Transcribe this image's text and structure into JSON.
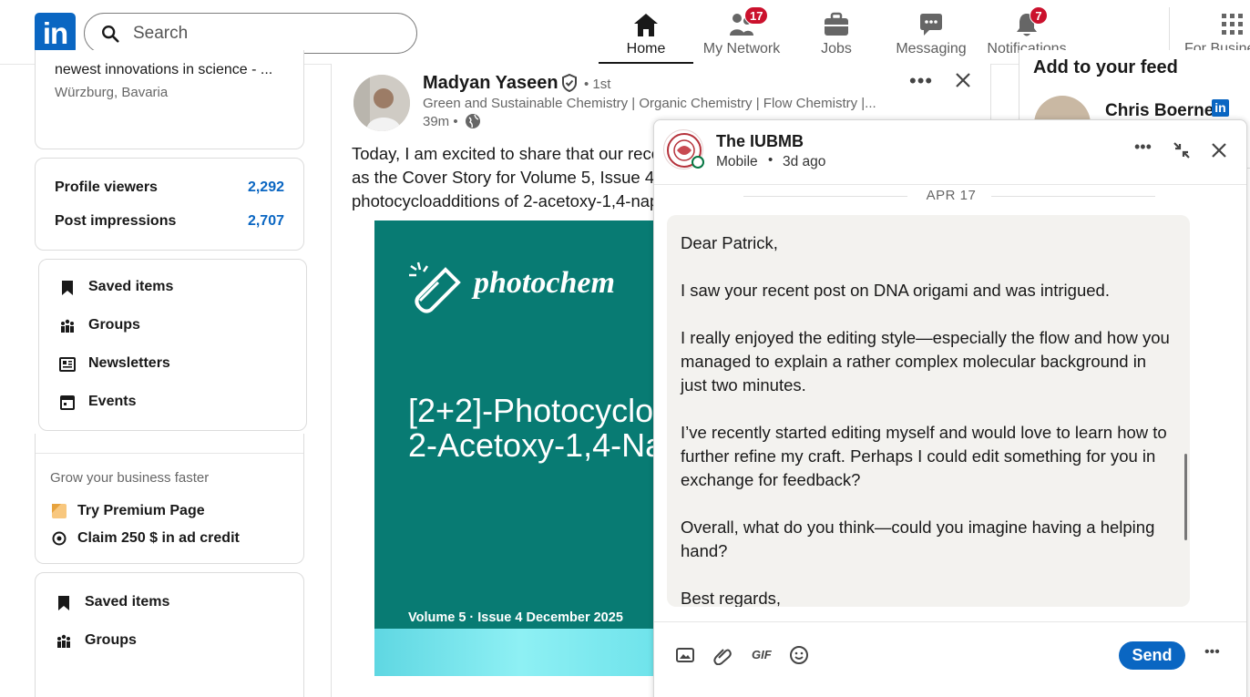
{
  "nav": {
    "logo": "in",
    "search_placeholder": "Search",
    "items": [
      {
        "label": "Home",
        "badge": ""
      },
      {
        "label": "My Network",
        "badge": "17"
      },
      {
        "label": "Jobs",
        "badge": ""
      },
      {
        "label": "Messaging",
        "badge": ""
      },
      {
        "label": "Notifications",
        "badge": "7"
      },
      {
        "label": "For Business",
        "badge": ""
      }
    ]
  },
  "left": {
    "profile": {
      "headline": "newest innovations in science - ...",
      "location": "Würzburg, Bavaria"
    },
    "stats": [
      {
        "label": "Profile viewers",
        "value": "2,292"
      },
      {
        "label": "Post impressions",
        "value": "2,707"
      }
    ],
    "menu1": [
      "Saved items",
      "Groups",
      "Newsletters",
      "Events"
    ],
    "premium": {
      "heading": "Grow your business faster",
      "items": [
        "Try Premium Page",
        "Claim 250 $ in ad credit"
      ]
    },
    "menu2": [
      "Saved items",
      "Groups"
    ]
  },
  "post": {
    "author": "Madyan Yaseen",
    "degree": "• 1st",
    "headline": "Green and Sustainable Chemistry | Organic Chemistry | Flow Chemistry |...",
    "time": "39m •",
    "text_lines": [
      "Today, I am excited to share that our rece",
      "as the Cover Story for Volume 5, Issue 4. C",
      "photocycloadditions of 2-acetoxy-1,4-nap"
    ],
    "cover": {
      "journal": "photochem",
      "title_line1": "[2+2]-Photocyclo",
      "title_line2": "2-Acetoxy-1,4-Na",
      "footer": "Volume 5 · Issue 4 December 2025"
    }
  },
  "right": {
    "heading": "Add to your feed",
    "person": "Chris Boerner"
  },
  "message": {
    "name": "The IUBMB",
    "status": "Mobile",
    "ago": "3d ago",
    "date": "APR 17",
    "paragraphs": [
      "Dear Patrick,",
      "I saw your recent post on DNA origami and was intrigued.",
      "I really enjoyed the editing style—especially the flow and how you managed to explain a rather complex molecular background in just two minutes.",
      "I’ve recently started editing myself and would love to learn how to further refine my craft. Perhaps I could edit something for you in exchange for feedback?",
      "Overall, what do you think—could you imagine having a helping hand?",
      "Best regards,"
    ],
    "send_label": "Send",
    "gif_label": "GIF",
    "send_color": "#0a66c2"
  }
}
